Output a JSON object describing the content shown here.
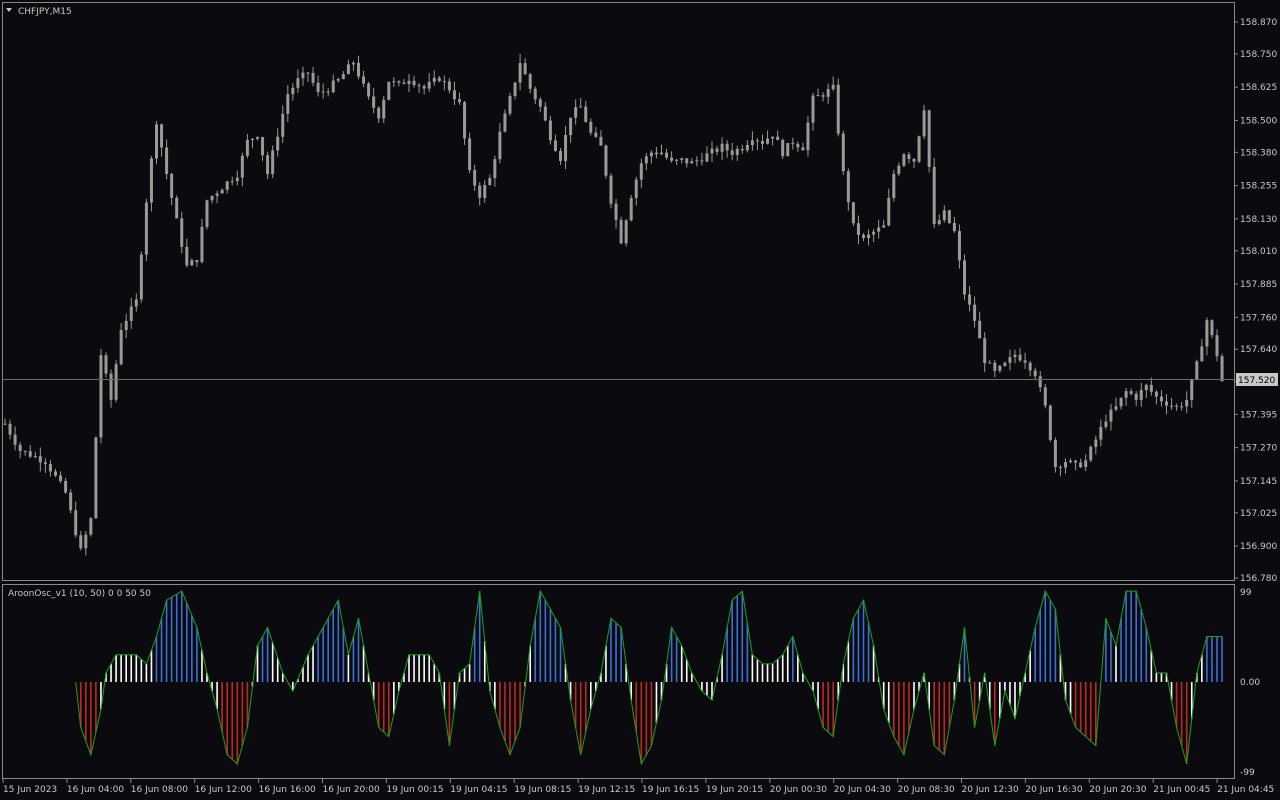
{
  "window": {
    "title": "CHFJPY,M15"
  },
  "colors": {
    "background": "#0b0b0f",
    "frame": "#8a8a8a",
    "candle": "#9a9a9a",
    "text": "#c8c8c8",
    "osc_line": "#1aa31a",
    "osc_up_strong": "#3a6fd8",
    "osc_neutral": "#ffffff",
    "osc_down_strong": "#c0281e",
    "bid_line": "#6a6a6a",
    "price_tag_bg": "#c8c8c8",
    "price_tag_text": "#000000"
  },
  "chart_data": [
    {
      "type": "candlestick",
      "title": "CHFJPY,M15",
      "ylim": [
        156.78,
        158.9
      ],
      "y_ticks": [
        "158.870",
        "158.750",
        "158.625",
        "158.500",
        "158.380",
        "158.255",
        "158.130",
        "158.010",
        "157.885",
        "157.760",
        "157.640",
        "157.520",
        "157.395",
        "157.270",
        "157.145",
        "157.025",
        "156.900",
        "156.780"
      ],
      "current_price": "157.520",
      "x_ticks": [
        "15 Jun 2023",
        "16 Jun 04:00",
        "16 Jun 08:00",
        "16 Jun 12:00",
        "16 Jun 16:00",
        "16 Jun 20:00",
        "19 Jun 00:15",
        "19 Jun 04:15",
        "19 Jun 08:15",
        "19 Jun 12:15",
        "19 Jun 16:15",
        "19 Jun 20:15",
        "20 Jun 00:30",
        "20 Jun 04:30",
        "20 Jun 08:30",
        "20 Jun 12:30",
        "20 Jun 16:30",
        "20 Jun 20:30",
        "21 Jun 00:45",
        "21 Jun 04:45"
      ],
      "close_path": [
        [
          0,
          157.36
        ],
        [
          3,
          157.26
        ],
        [
          8,
          157.22
        ],
        [
          12,
          157.1
        ],
        [
          15,
          156.88
        ],
        [
          17,
          157.0
        ],
        [
          19,
          157.62
        ],
        [
          21,
          157.45
        ],
        [
          23,
          157.72
        ],
        [
          26,
          157.82
        ],
        [
          28,
          158.2
        ],
        [
          30,
          158.5
        ],
        [
          32,
          158.3
        ],
        [
          34,
          158.12
        ],
        [
          36,
          157.95
        ],
        [
          38,
          157.98
        ],
        [
          40,
          158.2
        ],
        [
          43,
          158.25
        ],
        [
          46,
          158.3
        ],
        [
          48,
          158.42
        ],
        [
          50,
          158.45
        ],
        [
          52,
          158.3
        ],
        [
          54,
          158.45
        ],
        [
          56,
          158.6
        ],
        [
          58,
          158.65
        ],
        [
          60,
          158.68
        ],
        [
          62,
          158.6
        ],
        [
          64,
          158.62
        ],
        [
          66,
          158.65
        ],
        [
          69,
          158.72
        ],
        [
          72,
          158.58
        ],
        [
          74,
          158.52
        ],
        [
          76,
          158.65
        ],
        [
          78,
          158.63
        ],
        [
          80,
          158.66
        ],
        [
          83,
          158.62
        ],
        [
          86,
          158.66
        ],
        [
          88,
          158.62
        ],
        [
          90,
          158.56
        ],
        [
          92,
          158.3
        ],
        [
          94,
          158.22
        ],
        [
          96,
          158.28
        ],
        [
          98,
          158.45
        ],
        [
          100,
          158.58
        ],
        [
          102,
          158.72
        ],
        [
          104,
          158.62
        ],
        [
          106,
          158.55
        ],
        [
          108,
          158.44
        ],
        [
          110,
          158.36
        ],
        [
          112,
          158.52
        ],
        [
          114,
          158.55
        ],
        [
          116,
          158.45
        ],
        [
          118,
          158.4
        ],
        [
          120,
          158.2
        ],
        [
          122,
          158.05
        ],
        [
          124,
          158.22
        ],
        [
          126,
          158.34
        ],
        [
          128,
          158.38
        ],
        [
          130,
          158.38
        ],
        [
          132,
          158.34
        ],
        [
          134,
          158.35
        ],
        [
          136,
          158.34
        ],
        [
          138,
          158.36
        ],
        [
          140,
          158.38
        ],
        [
          142,
          158.4
        ],
        [
          144,
          158.38
        ],
        [
          146,
          158.4
        ],
        [
          148,
          158.44
        ],
        [
          150,
          158.42
        ],
        [
          152,
          158.45
        ],
        [
          154,
          158.38
        ],
        [
          156,
          158.42
        ],
        [
          158,
          158.4
        ],
        [
          160,
          158.58
        ],
        [
          162,
          158.6
        ],
        [
          164,
          158.62
        ],
        [
          166,
          158.3
        ],
        [
          168,
          158.1
        ],
        [
          170,
          158.05
        ],
        [
          172,
          158.08
        ],
        [
          174,
          158.1
        ],
        [
          176,
          158.3
        ],
        [
          178,
          158.38
        ],
        [
          180,
          158.35
        ],
        [
          182,
          158.55
        ],
        [
          184,
          158.1
        ],
        [
          186,
          158.15
        ],
        [
          188,
          158.08
        ],
        [
          190,
          157.85
        ],
        [
          192,
          157.75
        ],
        [
          194,
          157.6
        ],
        [
          196,
          157.55
        ],
        [
          198,
          157.58
        ],
        [
          200,
          157.62
        ],
        [
          202,
          157.6
        ],
        [
          204,
          157.55
        ],
        [
          206,
          157.42
        ],
        [
          208,
          157.2
        ],
        [
          210,
          157.22
        ],
        [
          212,
          157.2
        ],
        [
          214,
          157.22
        ],
        [
          216,
          157.3
        ],
        [
          218,
          157.38
        ],
        [
          220,
          157.42
        ],
        [
          222,
          157.48
        ],
        [
          224,
          157.46
        ],
        [
          226,
          157.5
        ],
        [
          228,
          157.46
        ],
        [
          230,
          157.44
        ],
        [
          232,
          157.42
        ],
        [
          234,
          157.45
        ],
        [
          236,
          157.58
        ],
        [
          238,
          157.75
        ],
        [
          240,
          157.62
        ],
        [
          241,
          157.52
        ]
      ],
      "oscillator": {
        "name": "AroonOsc_v1 (10, 50) 0 0 50 50",
        "ylim": [
          -99,
          99
        ],
        "y_ticks": [
          "99",
          "0.00",
          "-99"
        ],
        "levels": [
          50,
          -50
        ],
        "path": [
          [
            0,
            0
          ],
          [
            14,
            0
          ],
          [
            15,
            -50
          ],
          [
            17,
            -80
          ],
          [
            19,
            -30
          ],
          [
            20,
            10
          ],
          [
            22,
            30
          ],
          [
            26,
            30
          ],
          [
            28,
            20
          ],
          [
            30,
            50
          ],
          [
            32,
            90
          ],
          [
            35,
            100
          ],
          [
            38,
            60
          ],
          [
            40,
            10
          ],
          [
            42,
            -30
          ],
          [
            44,
            -80
          ],
          [
            46,
            -90
          ],
          [
            48,
            -50
          ],
          [
            50,
            40
          ],
          [
            52,
            60
          ],
          [
            55,
            10
          ],
          [
            57,
            -10
          ],
          [
            60,
            30
          ],
          [
            63,
            60
          ],
          [
            66,
            90
          ],
          [
            68,
            30
          ],
          [
            70,
            70
          ],
          [
            72,
            10
          ],
          [
            74,
            -50
          ],
          [
            76,
            -60
          ],
          [
            78,
            -10
          ],
          [
            80,
            30
          ],
          [
            84,
            30
          ],
          [
            86,
            10
          ],
          [
            88,
            -70
          ],
          [
            90,
            10
          ],
          [
            92,
            20
          ],
          [
            94,
            100
          ],
          [
            96,
            -10
          ],
          [
            98,
            -50
          ],
          [
            100,
            -80
          ],
          [
            102,
            -50
          ],
          [
            104,
            40
          ],
          [
            106,
            100
          ],
          [
            108,
            80
          ],
          [
            110,
            60
          ],
          [
            112,
            -20
          ],
          [
            114,
            -80
          ],
          [
            116,
            -30
          ],
          [
            118,
            10
          ],
          [
            120,
            70
          ],
          [
            122,
            60
          ],
          [
            124,
            -20
          ],
          [
            126,
            -90
          ],
          [
            128,
            -70
          ],
          [
            130,
            -20
          ],
          [
            132,
            60
          ],
          [
            134,
            40
          ],
          [
            136,
            10
          ],
          [
            138,
            -10
          ],
          [
            140,
            -20
          ],
          [
            142,
            30
          ],
          [
            144,
            90
          ],
          [
            146,
            100
          ],
          [
            148,
            30
          ],
          [
            150,
            20
          ],
          [
            152,
            20
          ],
          [
            154,
            30
          ],
          [
            156,
            50
          ],
          [
            158,
            10
          ],
          [
            160,
            -10
          ],
          [
            162,
            -50
          ],
          [
            164,
            -60
          ],
          [
            166,
            20
          ],
          [
            168,
            70
          ],
          [
            170,
            90
          ],
          [
            172,
            40
          ],
          [
            174,
            -30
          ],
          [
            176,
            -60
          ],
          [
            178,
            -80
          ],
          [
            180,
            -30
          ],
          [
            182,
            10
          ],
          [
            184,
            -70
          ],
          [
            186,
            -80
          ],
          [
            188,
            -20
          ],
          [
            190,
            60
          ],
          [
            192,
            -50
          ],
          [
            194,
            10
          ],
          [
            196,
            -70
          ],
          [
            198,
            -10
          ],
          [
            200,
            -40
          ],
          [
            202,
            10
          ],
          [
            204,
            60
          ],
          [
            206,
            100
          ],
          [
            208,
            80
          ],
          [
            210,
            -20
          ],
          [
            212,
            -50
          ],
          [
            214,
            -60
          ],
          [
            216,
            -70
          ],
          [
            218,
            70
          ],
          [
            220,
            40
          ],
          [
            222,
            100
          ],
          [
            224,
            100
          ],
          [
            226,
            60
          ],
          [
            228,
            10
          ],
          [
            230,
            10
          ],
          [
            232,
            -50
          ],
          [
            234,
            -90
          ],
          [
            236,
            10
          ],
          [
            238,
            50
          ],
          [
            241,
            50
          ]
        ]
      }
    }
  ]
}
